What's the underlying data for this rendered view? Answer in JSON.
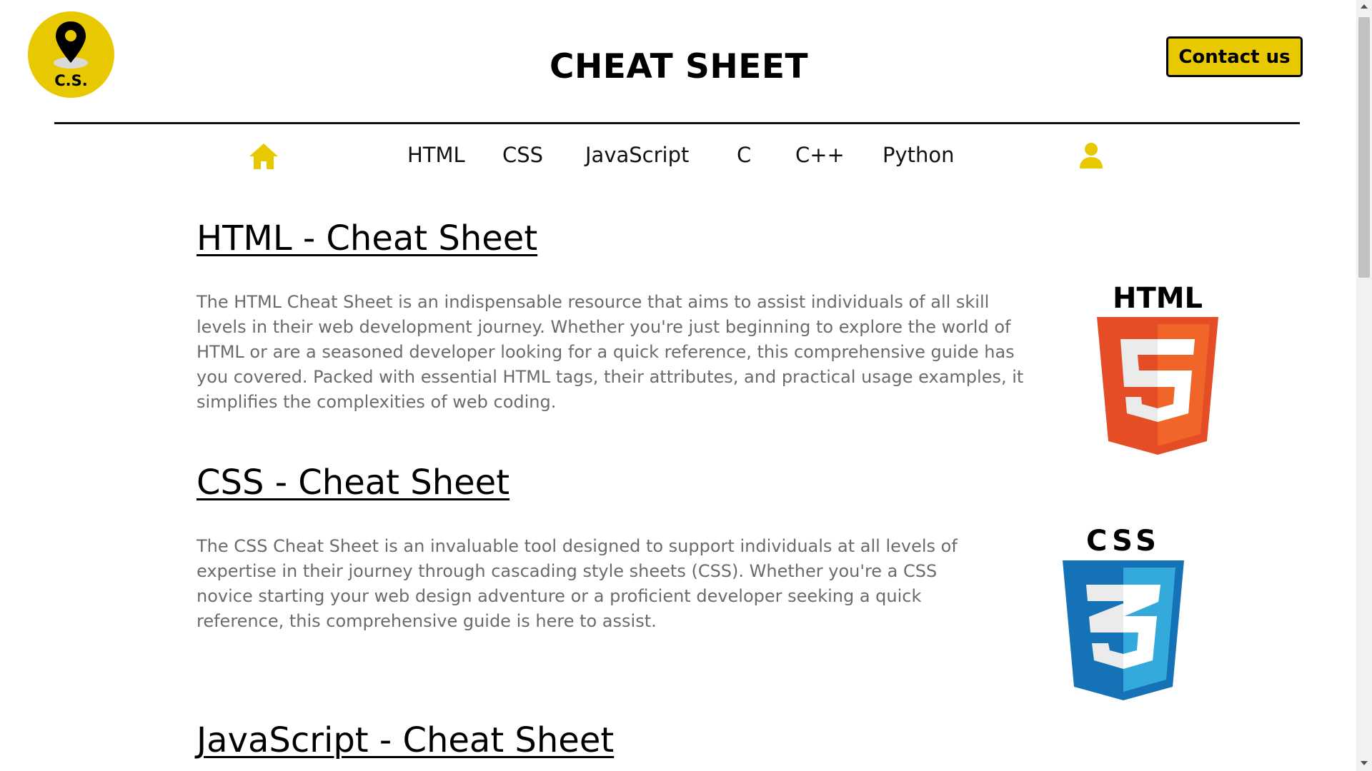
{
  "header": {
    "logo_text": "C.S.",
    "title": "CHEAT SHEET",
    "contact_label": "Contact us"
  },
  "nav": {
    "home_icon": "home-icon",
    "user_icon": "user-icon",
    "links": [
      "HTML",
      "CSS",
      "JavaScript",
      "C",
      "C++",
      "Python"
    ]
  },
  "sections": [
    {
      "title": "HTML - Cheat Sheet",
      "description": "The HTML Cheat Sheet is an indispensable resource that aims to assist individuals of all skill levels in their web development journey. Whether you're just beginning to explore the world of HTML or are a seasoned developer looking for a quick reference, this comprehensive guide has you covered. Packed with essential HTML tags, their attributes, and practical usage examples, it simplifies the complexities of web coding.",
      "logo_text": "HTML"
    },
    {
      "title": "CSS - Cheat Sheet",
      "description": "The CSS Cheat Sheet is an invaluable tool designed to support individuals at all levels of expertise in their journey through cascading style sheets (CSS). Whether you're a CSS novice starting your web design adventure or a proficient developer seeking a quick reference, this comprehensive guide is here to assist.",
      "logo_text": "CSS"
    },
    {
      "title": "JavaScript - Cheat Sheet"
    }
  ],
  "colors": {
    "accent": "#e8c800",
    "text": "#000000",
    "muted_text": "#6b6b6b",
    "html_orange": "#e44d26",
    "html_orange_light": "#f16529",
    "css_blue": "#1572b6",
    "css_blue_light": "#33a9dc"
  }
}
